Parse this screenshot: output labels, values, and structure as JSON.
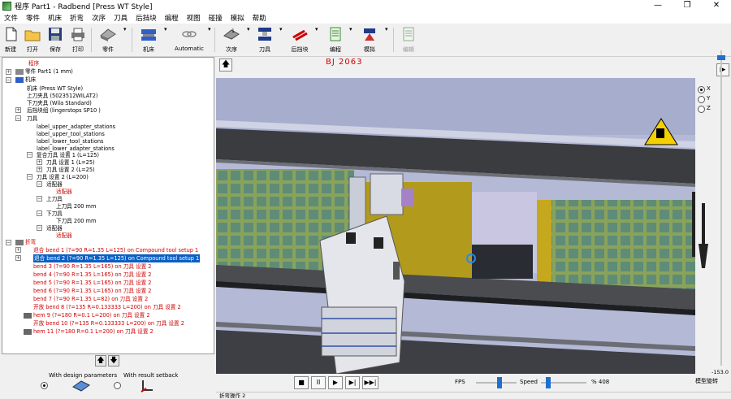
{
  "window": {
    "title": "程序 Part1 - Radbend [Press WT Style]",
    "minimize": "—",
    "maximize": "❐",
    "close": "✕"
  },
  "menu": [
    "文件",
    "零件",
    "机床",
    "折弯",
    "次序",
    "刀具",
    "后挡块",
    "编程",
    "视图",
    "碰撞",
    "模拟",
    "帮助"
  ],
  "toolbar": {
    "new": "新建",
    "open": "打开",
    "save": "保存",
    "print": "打印",
    "part": "零件",
    "machine": "机床",
    "automatic": "Automatic",
    "sequence": "次序",
    "tools": "刀具",
    "backgauge": "后挡块",
    "programming": "编程",
    "simulate": "模拟",
    "edit": "编辑"
  },
  "tree": {
    "program": "程序",
    "part": "零件 Part1 (1 mm)",
    "machine": "机床",
    "machine_detail": "机床 (Press WT Style)",
    "upper_clamp": "上刀夹具 (5023512WILAT2)",
    "lower_clamp": "下刀夹具 (Wila Standard)",
    "backgauge": "后挡块组 (lingerstops SP10 )",
    "tools": "刀具",
    "stations": [
      "label_upper_adapter_stations",
      "label_upper_tool_stations",
      "label_lower_tool_stations",
      "label_lower_adapter_stations"
    ],
    "compound_setup": "复合刀具 设置 1 (L=125)",
    "tool_setup_1": "刀具 设置 1 (L=25)",
    "tool_setup_2": "刀具 设置 2 (L=25)",
    "tool_setup_big": "刀具 设置 2 (L=200)",
    "adapter": "适配器",
    "upper_tool": "上刀具",
    "upper_tool_len": "上刀具 200 mm",
    "lower_tool": "下刀具",
    "lower_tool_len": "下刀具 200 mm",
    "bends_header": "折弯",
    "bends": [
      "退合 bend 1 (?=90 R=1.35 L=125) on Compound tool setup 1",
      "退合 bend 2 (?=90 R=1.35 L=125) on Compound tool setup 1",
      "bend 3 (?=90 R=1.35 L=165) on 刀具 设置 2",
      "bend 4 (?=90 R=1.35 L=165) on 刀具 设置 2",
      "bend 5 (?=90 R=1.35 L=165) on 刀具 设置 2",
      "bend 6 (?=90 R=1.35 L=165) on 刀具 设置 2",
      "bend 7 (?=90 R=1.35 L=82) on 刀具 设置 2",
      "开放 bend 8 (?=135 R=0.133333 L=200) on 刀具 设置 2",
      "hem 9 (?=180 R=0.1 L=200) on 刀具 设置 2",
      "开放 bend 10 (?=135 R=0.133333 L=200) on 刀具 设置 2",
      "hem 11 (?=180 R=0.1 L=200) on 刀具 设置 2"
    ]
  },
  "options": {
    "design_params": "With design parameters",
    "result_setback": "With result setback"
  },
  "axis": {
    "x": "X",
    "y": "Y",
    "z": "Z"
  },
  "viewport_label": "BJ 2063",
  "playback": {
    "fps_label": "FPS",
    "speed_label": "Speed",
    "percent": "% 408",
    "stop": "■",
    "pause": "II",
    "play": "▶",
    "next": "▶|",
    "end": "▶▶|"
  },
  "side_value": "-153.0",
  "model_rotate": "模型旋转",
  "status": "折弯操作 2"
}
